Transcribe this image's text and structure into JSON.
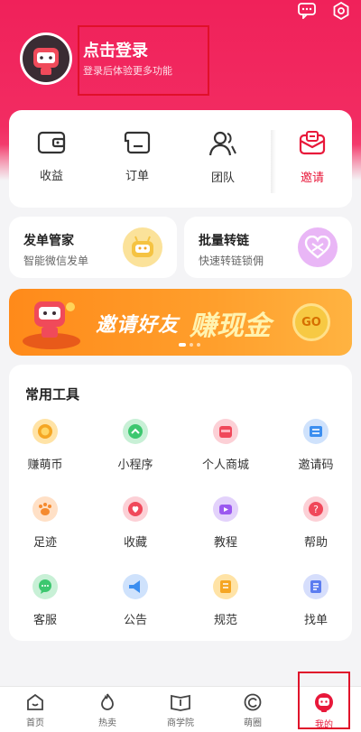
{
  "header": {
    "login_title": "点击登录",
    "login_subtitle": "登录后体验更多功能"
  },
  "quick_actions": [
    {
      "label": "收益",
      "icon": "wallet-icon"
    },
    {
      "label": "订单",
      "icon": "order-icon"
    },
    {
      "label": "团队",
      "icon": "team-icon"
    },
    {
      "label": "邀请",
      "icon": "invite-icon",
      "accent": "#e8183a"
    }
  ],
  "features": [
    {
      "title": "发单管家",
      "subtitle": "智能微信发单",
      "icon": "robot-icon",
      "color": "#f5c342"
    },
    {
      "title": "批量转链",
      "subtitle": "快速转链锁佣",
      "icon": "link-icon",
      "color": "#d77bf0"
    }
  ],
  "banner": {
    "text1": "邀请好友",
    "text2": "赚现金",
    "go_label": "GO"
  },
  "tools": {
    "title": "常用工具",
    "items": [
      {
        "label": "赚萌币",
        "icon": "coin-icon",
        "color": "#f5a623"
      },
      {
        "label": "小程序",
        "icon": "mini-program-icon",
        "color": "#3cc76f"
      },
      {
        "label": "个人商城",
        "icon": "shop-icon",
        "color": "#f0485a"
      },
      {
        "label": "邀请码",
        "icon": "invite-code-icon",
        "color": "#3b8ef0"
      },
      {
        "label": "足迹",
        "icon": "footprint-icon",
        "color": "#f58a2e"
      },
      {
        "label": "收藏",
        "icon": "favorite-icon",
        "color": "#f0485a"
      },
      {
        "label": "教程",
        "icon": "tutorial-icon",
        "color": "#9b59f0"
      },
      {
        "label": "帮助",
        "icon": "help-icon",
        "color": "#f0485a"
      },
      {
        "label": "客服",
        "icon": "service-icon",
        "color": "#3cc76f"
      },
      {
        "label": "公告",
        "icon": "announcement-icon",
        "color": "#3b8ef0"
      },
      {
        "label": "规范",
        "icon": "rules-icon",
        "color": "#f5a623"
      },
      {
        "label": "找单",
        "icon": "find-order-icon",
        "color": "#5b7cf0"
      }
    ]
  },
  "tabbar": [
    {
      "label": "首页",
      "icon": "home-icon"
    },
    {
      "label": "热卖",
      "icon": "fire-icon"
    },
    {
      "label": "商学院",
      "icon": "book-icon"
    },
    {
      "label": "萌圈",
      "icon": "circle-icon"
    },
    {
      "label": "我的",
      "icon": "profile-icon",
      "active": true
    }
  ],
  "colors": {
    "brand": "#f0215a",
    "active_tab": "#e8183a"
  }
}
